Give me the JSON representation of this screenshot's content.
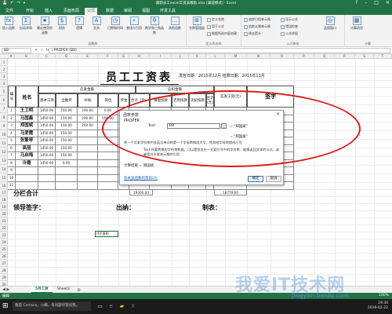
{
  "window": {
    "title": "最新员工excel工资表模板.xlsx [兼容模式] - Excel",
    "qat": [
      "💾",
      "↶",
      "↷",
      "▾"
    ],
    "controls": [
      "?",
      "–",
      "□",
      "✕"
    ]
  },
  "ribbon_tabs": [
    "文件",
    "开始",
    "插入",
    "页面布局",
    "公式",
    "数据",
    "审阅",
    "视图",
    "开发工具"
  ],
  "active_tab_index": 4,
  "ribbon": {
    "buttons": [
      "插入函数",
      "自动求和",
      "最近使用的函数",
      "财务",
      "逻辑",
      "文本",
      "日期和时间",
      "查找与引用",
      "数学和三角函数",
      "其他函数"
    ],
    "group1_label": "函数库",
    "defined_names": [
      "定义名称",
      "用于公式",
      "根据所选内容创建"
    ],
    "name_manager": "名称管理器",
    "group2_label": "定义的名称",
    "audit": [
      "追踪引用单元格",
      "追踪从属单元格",
      "移去箭头"
    ],
    "audit2": [
      "显示公式",
      "错误检查",
      "公式求值"
    ],
    "watch": "监视窗口",
    "group3_label": "公式审核",
    "calc_options": "计算选项",
    "group4_label": "计算"
  },
  "formula_bar": {
    "name_box": "B8",
    "fx_icons": [
      "✕",
      "✓",
      "fx"
    ],
    "formula": "=PROPER (B8)"
  },
  "columns": [
    "A",
    "B",
    "C",
    "D",
    "E",
    "F",
    "G",
    "H",
    "I",
    "J",
    "K",
    "L",
    "M",
    "N",
    "O",
    "P",
    "Q",
    "R",
    "S",
    "T"
  ],
  "rows": [
    "1",
    "2",
    "3",
    "4",
    "5",
    "6",
    "7",
    "8",
    "9",
    "10",
    "11",
    "12",
    "13",
    "14",
    "15",
    "16",
    "17",
    "18",
    "19",
    "20",
    "21",
    "22",
    "23",
    "24",
    "25",
    "26",
    "27",
    "28",
    "29",
    "30"
  ],
  "sheet": {
    "title": "员工工资表",
    "dateline": "发放日期：2015年12月  结算日期：2015年11月",
    "headers": {
      "serial": "编号",
      "name": "姓名",
      "payable": "应发金额",
      "deduct": "应扣金额",
      "actual": "实发工资(元)",
      "sign": "签字",
      "sub": [
        "基本工资",
        "全勤奖",
        "补助",
        "岗位",
        "奖金",
        "合计（元）",
        "请假扣款",
        "迟到扣款",
        "违纪扣款",
        "合计（元）"
      ]
    },
    "employees": [
      {
        "no": "1",
        "name": "王卫明",
        "basic": "1450.00",
        "attend": "150.00",
        "sub": "200.00",
        "post": "0.00"
      },
      {
        "no": "2",
        "name": "马国鑫",
        "basic": "1450.00",
        "attend": "150.00",
        "sub": "200.00",
        "post": "500.00"
      },
      {
        "no": "3",
        "name": "郑国斌",
        "basic": "1450.00",
        "attend": "150.00",
        "sub": "200.00",
        "post": ""
      },
      {
        "no": "4",
        "name": "马爱霞",
        "basic": "1450.00",
        "attend": "150.00",
        "sub": "",
        "post": ""
      },
      {
        "no": "5",
        "name": "张繁琴",
        "basic": "1450.00",
        "attend": "150.00",
        "sub": "",
        "post": ""
      },
      {
        "no": "6",
        "name": "高丽",
        "basic": "1450.00",
        "attend": "150.00",
        "sub": "",
        "post": ""
      },
      {
        "no": "7",
        "name": "马启梅",
        "basic": "1450.00",
        "attend": "150.00",
        "sub": "",
        "post": ""
      },
      {
        "no": "8",
        "name": "冷霜",
        "basic": "1450.00",
        "attend": "0.00",
        "sub": "",
        "post": ""
      },
      {
        "no": "9",
        "name": "",
        "basic": "",
        "attend": "",
        "sub": "",
        "post": ""
      },
      {
        "no": "10",
        "name": "",
        "basic": "",
        "attend": "",
        "sub": "",
        "post": ""
      },
      {
        "no": "11",
        "name": "",
        "basic": "",
        "attend": "",
        "sub": "",
        "post": ""
      }
    ],
    "subtotal_label": "分栏合计",
    "subtotal_total": "19300.00",
    "subtotal_actual": "18770.00",
    "leader_sign": "领导签字：",
    "cashier": "出纳：",
    "preparer": "制表：",
    "active_cell_value": "(F|F|B8)"
  },
  "dialog": {
    "title": "函数参数",
    "close": "✕",
    "function_name": "PROPER",
    "arg_label": "Text",
    "arg_value": "B8",
    "arg_result": "= \"郑国斌\"",
    "result2": "= \"郑国斌\"",
    "description": "将一个文本字符串中各英文单词的第一个字母转换成大写，将其他字母转换成小写",
    "arg_description": "Text  所要转换的字符串数据，可以是包含在一对双引号中的字符串、能够返回文本的公式，或者是对文本单元格的引用",
    "calc_result": "计算结果 = 郑国斌",
    "help_link": "有关该函数的帮助(H)",
    "ok": "确定",
    "cancel": "取消"
  },
  "sheet_tabs": [
    "5月工资",
    "Sheet3"
  ],
  "sheet_nav": "◀ ▶",
  "add_sheet": "⊕",
  "status": {
    "mode": "编辑",
    "zoom": "100%"
  },
  "taskbar": {
    "search_placeholder": "我是 Cortana，小娜。有问题尽管问我。",
    "time": "19:30",
    "date": "2016-02-22"
  },
  "watermark": {
    "text": "我爱IT技术网",
    "sub": "jingyan.baidu.com"
  },
  "colors": {
    "excel_green": "#217346",
    "highlight_red": "#e01818"
  }
}
